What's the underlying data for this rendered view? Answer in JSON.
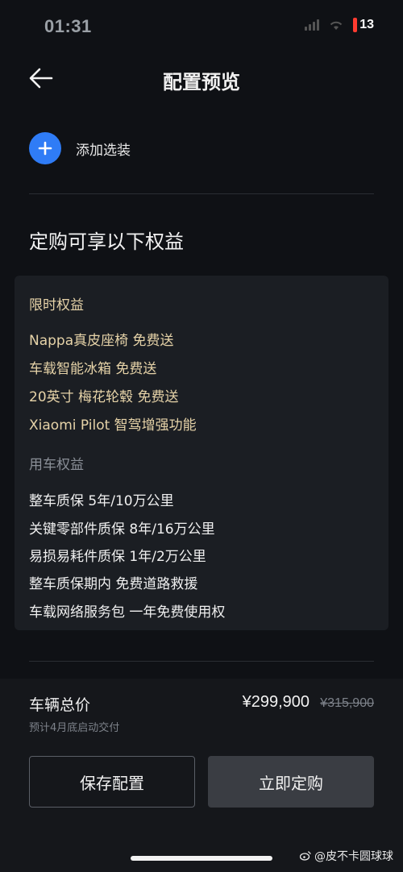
{
  "status_bar": {
    "time": "01:31",
    "battery": "13"
  },
  "header": {
    "title": "配置预览",
    "back_icon": "arrow-left-icon"
  },
  "add_option": {
    "icon": "plus-icon",
    "label": "添加选装"
  },
  "benefits": {
    "title": "定购可享以下权益",
    "limited": {
      "heading": "限时权益",
      "items": [
        "Nappa真皮座椅 免费送",
        "车载智能冰箱 免费送",
        "20英寸 梅花轮毂 免费送",
        "Xiaomi Pilot 智驾增强功能"
      ]
    },
    "usage": {
      "heading": "用车权益",
      "items": [
        "整车质保 5年/10万公里",
        "关键零部件质保 8年/16万公里",
        "易损易耗件质保 1年/2万公里",
        "整车质保期内 免费道路救援",
        "车载网络服务包 一年免费使用权"
      ]
    }
  },
  "summary": {
    "total_label": "车辆总价",
    "delivery_note": "预计4月底启动交付",
    "price": "¥299,900",
    "original_price": "¥315,900"
  },
  "actions": {
    "save_label": "保存配置",
    "order_label": "立即定购"
  },
  "watermark": "@皮不卡圆球球",
  "colors": {
    "background": "#0f1115",
    "accent_blue": "#2f7cf6",
    "gold_text": "#e6d3a8",
    "battery_red": "#ff3b30"
  }
}
